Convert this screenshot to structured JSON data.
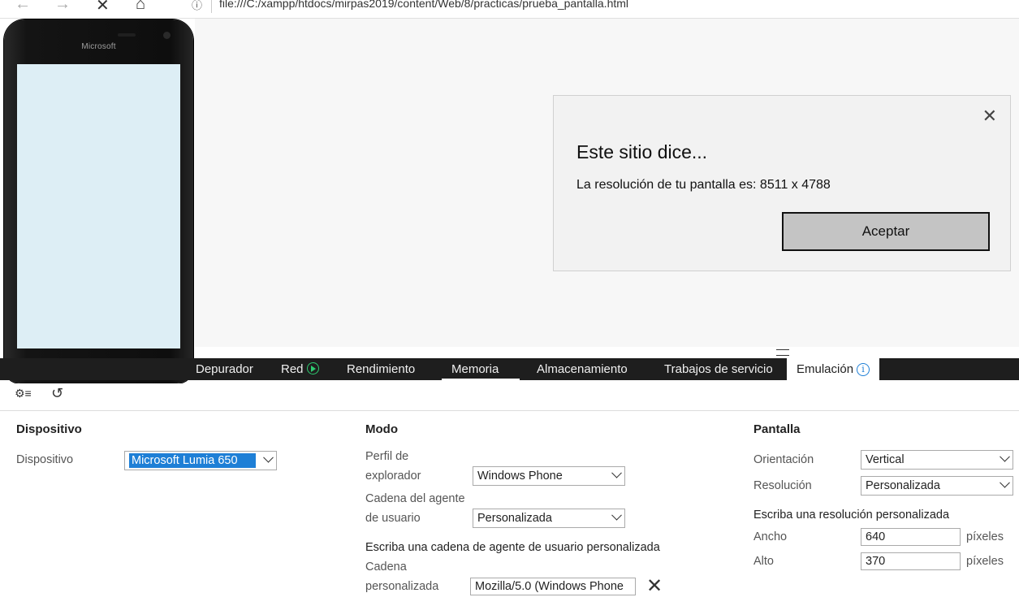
{
  "browser": {
    "url": "file:///C:/xampp/htdocs/mirpas2019/content/Web/8/practicas/prueba_pantalla.html"
  },
  "phone": {
    "brand": "Microsoft"
  },
  "dialog": {
    "title": "Este sitio dice...",
    "message": "La resolución de tu pantalla es: 8511 x 4788",
    "ok_label": "Aceptar"
  },
  "tabs": [
    {
      "label": "Depurador"
    },
    {
      "label": "Red"
    },
    {
      "label": "Rendimiento"
    },
    {
      "label": "Memoria"
    },
    {
      "label": "Almacenamiento"
    },
    {
      "label": "Trabajos de servicio"
    },
    {
      "label": "Emulación"
    }
  ],
  "dispositivo": {
    "heading": "Dispositivo",
    "device_label": "Dispositivo",
    "device_value": "Microsoft Lumia 650"
  },
  "modo": {
    "heading": "Modo",
    "profile_label_1": "Perfil de",
    "profile_label_2": "explorador",
    "profile_value": "Windows Phone",
    "ua_label_1": "Cadena del agente",
    "ua_label_2": "de usuario",
    "ua_value": "Personalizada",
    "custom_ua_prompt": "Escriba una cadena de agente de usuario personalizada",
    "custom_label_1": "Cadena",
    "custom_label_2": "personalizada",
    "custom_value": "Mozilla/5.0 (Windows Phone"
  },
  "pantalla": {
    "heading": "Pantalla",
    "orientation_label": "Orientación",
    "orientation_value": "Vertical",
    "resolution_label": "Resolución",
    "resolution_value": "Personalizada",
    "custom_res_prompt": "Escriba una resolución personalizada",
    "width_label": "Ancho",
    "width_value": "640",
    "height_label": "Alto",
    "height_value": "370",
    "unit": "píxeles"
  },
  "colors": {
    "accent": "#1e7fd6",
    "tabbar": "#1e1e1e",
    "play": "#2ecc71",
    "phone_screen": "#ddeef5"
  }
}
